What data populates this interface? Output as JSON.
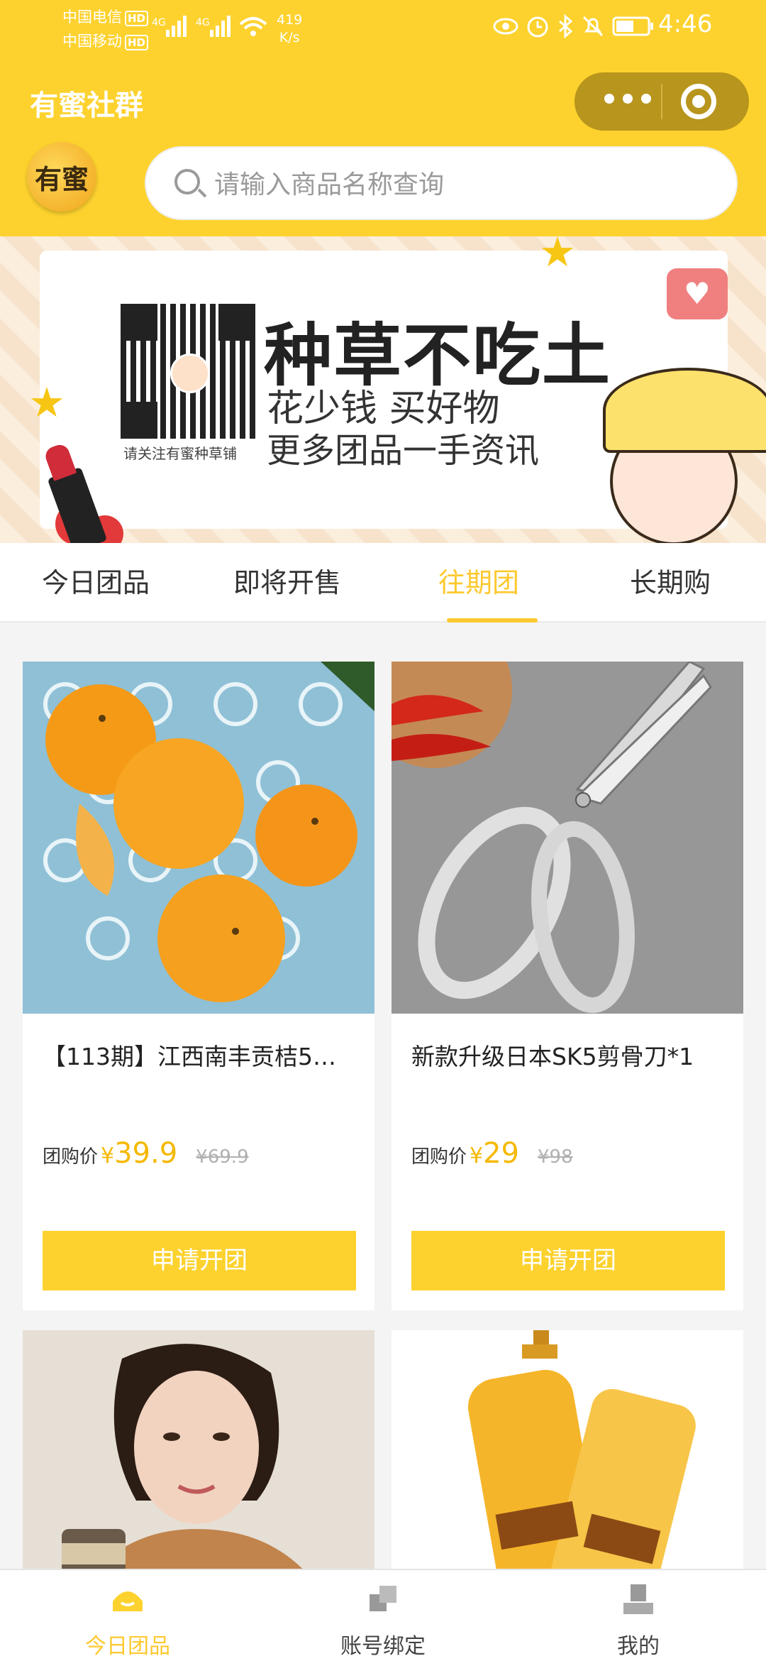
{
  "status_bar": {
    "carrier1": "中国电信",
    "carrier2": "中国移动",
    "hd": "HD",
    "net_speed": "419",
    "net_unit": "K/s",
    "time": "4:46"
  },
  "header": {
    "title": "有蜜社群",
    "logo_text": "有蜜",
    "search_placeholder": "请输入商品名称查询"
  },
  "banner": {
    "headline": "种草不吃土",
    "line2": "花少钱  买好物",
    "line3": "更多团品一手资讯",
    "qr_caption": "请关注有蜜种草铺"
  },
  "tabs": [
    {
      "label": "今日团品"
    },
    {
      "label": "即将开售"
    },
    {
      "label": "往期团",
      "active": true
    },
    {
      "label": "长期购"
    }
  ],
  "products": [
    {
      "name": "【113期】江西南丰贡桔5…",
      "price_label": "团购价",
      "currency": "¥",
      "price": "39.9",
      "old_price": "¥69.9",
      "button": "申请开团"
    },
    {
      "name": "新款升级日本SK5剪骨刀*1",
      "price_label": "团购价",
      "currency": "¥",
      "price": "29",
      "old_price": "¥98",
      "button": "申请开团"
    }
  ],
  "bottom_nav": [
    {
      "label": "今日团品",
      "active": true
    },
    {
      "label": "账号绑定"
    },
    {
      "label": "我的"
    }
  ],
  "colors": {
    "brand_yellow": "#fdd22e",
    "accent": "#fdc92f",
    "price": "#f5b800"
  }
}
